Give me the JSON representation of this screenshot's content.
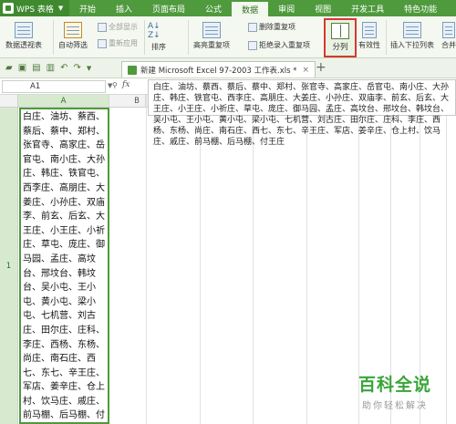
{
  "app": {
    "name": "WPS 表格"
  },
  "menu": [
    {
      "label": "开始"
    },
    {
      "label": "插入"
    },
    {
      "label": "页面布局"
    },
    {
      "label": "公式"
    },
    {
      "label": "数据",
      "active": true
    },
    {
      "label": "审阅"
    },
    {
      "label": "视图"
    },
    {
      "label": "开发工具"
    },
    {
      "label": "特色功能"
    }
  ],
  "ribbon": {
    "pivot": "数据透视表",
    "autofilter": "自动筛选",
    "show_all": "全部显示",
    "reapply": "重新应用",
    "sort": "排序",
    "highlight_dup": "高亮重复项",
    "delete_dup": "删除重复项",
    "reject_dup": "拒绝录入重复项",
    "split": "分列",
    "validity": "有效性",
    "insert_dropdown": "插入下拉列表",
    "merge": "合并"
  },
  "document_tab": {
    "title": "新建 Microsoft Excel 97-2003 工作表.xls *"
  },
  "formula_bar": {
    "name_box": "A1",
    "fx": "fx",
    "content": "白庄、油坊、蔡西、蔡后、蔡中、郑村、张官寺、高家庄、岳官屯、南小庄、大孙庄、韩庄、铁官屯、西李庄、高朋庄、大姜庄、小孙庄、双庙李、前玄、后玄、大王庄、小王庄、小祈庄、草屯、庞庄、御马园、孟庄、高坟台、邢坟台、韩坟台、吴小屯、王小屯、黄小屯、梁小屯、七机营、刘古庄、田尔庄、庄科、李庄、西杨、东杨、尚庄、南石庄、西七、东七、辛王庄、军店、姜辛庄、仓上村、饮马庄、戚庄、前马棚、后马棚、付王庄"
  },
  "columns": [
    "A",
    "B"
  ],
  "row": {
    "number": "1"
  },
  "cell_A1": "白庄、油坊、蔡西、蔡后、蔡中、郑村、张官寺、高家庄、岳官屯、南小庄、大孙庄、韩庄、铁官屯、西李庄、高朋庄、大姜庄、小孙庄、双庙李、前玄、后玄、大王庄、小王庄、小祈庄、草屯、庞庄、御马园、孟庄、高坟台、邢坟台、韩坟台、吴小屯、王小屯、黄小屯、梁小屯、七机营、刘古庄、田尔庄、庄科、李庄、西杨、东杨、尚庄、南石庄、西七、东七、辛王庄、军店、姜辛庄、仓上村、饮马庄、戚庄、前马棚、后马棚、付王庄",
  "watermark": {
    "title": "百科全说",
    "subtitle": "助你轻松解决"
  },
  "colors": {
    "accent": "#4e9a3c",
    "highlight_border": "#d23a2f"
  }
}
